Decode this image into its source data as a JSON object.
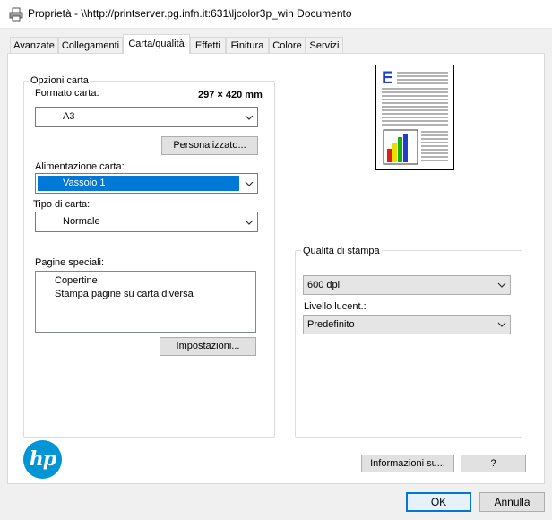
{
  "window": {
    "title": "Proprietà - \\\\http://printserver.pg.infn.it:631\\ljcolor3p_win Documento",
    "icon": "printer-icon"
  },
  "tabs": [
    {
      "label": "Avanzate",
      "active": false
    },
    {
      "label": "Collegamenti",
      "active": false
    },
    {
      "label": "Carta/qualità",
      "active": true
    },
    {
      "label": "Effetti",
      "active": false
    },
    {
      "label": "Finitura",
      "active": false
    },
    {
      "label": "Colore",
      "active": false
    },
    {
      "label": "Servizi",
      "active": false
    }
  ],
  "paper_options": {
    "legend": "Opzioni carta",
    "format_label": "Formato carta:",
    "format_size": "297 × 420 mm",
    "format_value": "A3",
    "custom_button": "Personalizzato...",
    "source_label": "Alimentazione carta:",
    "source_value": "Vassoio 1",
    "type_label": "Tipo di carta:",
    "type_value": "Normale",
    "special_label": "Pagine speciali:",
    "special_items": [
      "Copertine",
      "Stampa pagine su carta diversa"
    ],
    "settings_button": "Impostazioni..."
  },
  "print_quality": {
    "legend": "Qualità di stampa",
    "dpi_value": "600 dpi",
    "gloss_label": "Livello lucent.:",
    "gloss_value": "Predefinito"
  },
  "footer": {
    "about_button": "Informazioni su...",
    "help_button": "?",
    "ok_button": "OK",
    "cancel_button": "Annulla",
    "logo_text": "hp"
  },
  "colors": {
    "accent": "#0078d7",
    "hp_blue": "#0096d6",
    "preview_e": "#1f3fc6"
  }
}
